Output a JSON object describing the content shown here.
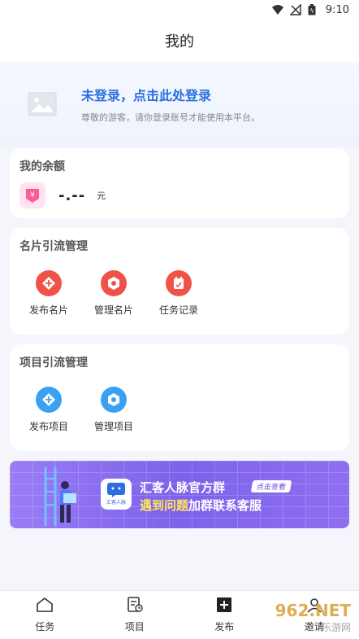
{
  "status": {
    "time": "9:10"
  },
  "header": {
    "title": "我的"
  },
  "login": {
    "title": "未登录，点击此处登录",
    "subtitle": "尊敬的游客，请你登录账号才能使用本平台。"
  },
  "balance": {
    "title": "我的余额",
    "icon": "yuan-icon",
    "value": "-.--",
    "unit": "元"
  },
  "card_mgmt": {
    "title": "名片引流管理",
    "items": [
      {
        "label": "发布名片",
        "icon": "publish-card-icon",
        "color": "#f0524a"
      },
      {
        "label": "管理名片",
        "icon": "manage-card-icon",
        "color": "#f0524a"
      },
      {
        "label": "任务记录",
        "icon": "task-record-icon",
        "color": "#f0524a"
      }
    ]
  },
  "project_mgmt": {
    "title": "项目引流管理",
    "items": [
      {
        "label": "发布项目",
        "icon": "publish-project-icon",
        "color": "#3aa0f2"
      },
      {
        "label": "管理项目",
        "icon": "manage-project-icon",
        "color": "#3aa0f2"
      }
    ]
  },
  "banner": {
    "logo_caption": "汇客人脉",
    "line1": "汇客人脉官方群",
    "badge": "点击查看",
    "line2_highlight": "遇到问题",
    "line2_rest": "加群联系客服"
  },
  "tabbar": {
    "items": [
      {
        "label": "任务",
        "icon": "home-icon"
      },
      {
        "label": "项目",
        "icon": "project-icon"
      },
      {
        "label": "发布",
        "icon": "plus-icon"
      },
      {
        "label": "邀请",
        "icon": "invite-icon"
      }
    ]
  },
  "watermark": {
    "text": "962.NET",
    "sub": "乐游网"
  },
  "colors": {
    "accent": "#2a6fe0",
    "red": "#f0524a",
    "blue": "#3aa0f2",
    "banner": "#8e6ff0"
  }
}
